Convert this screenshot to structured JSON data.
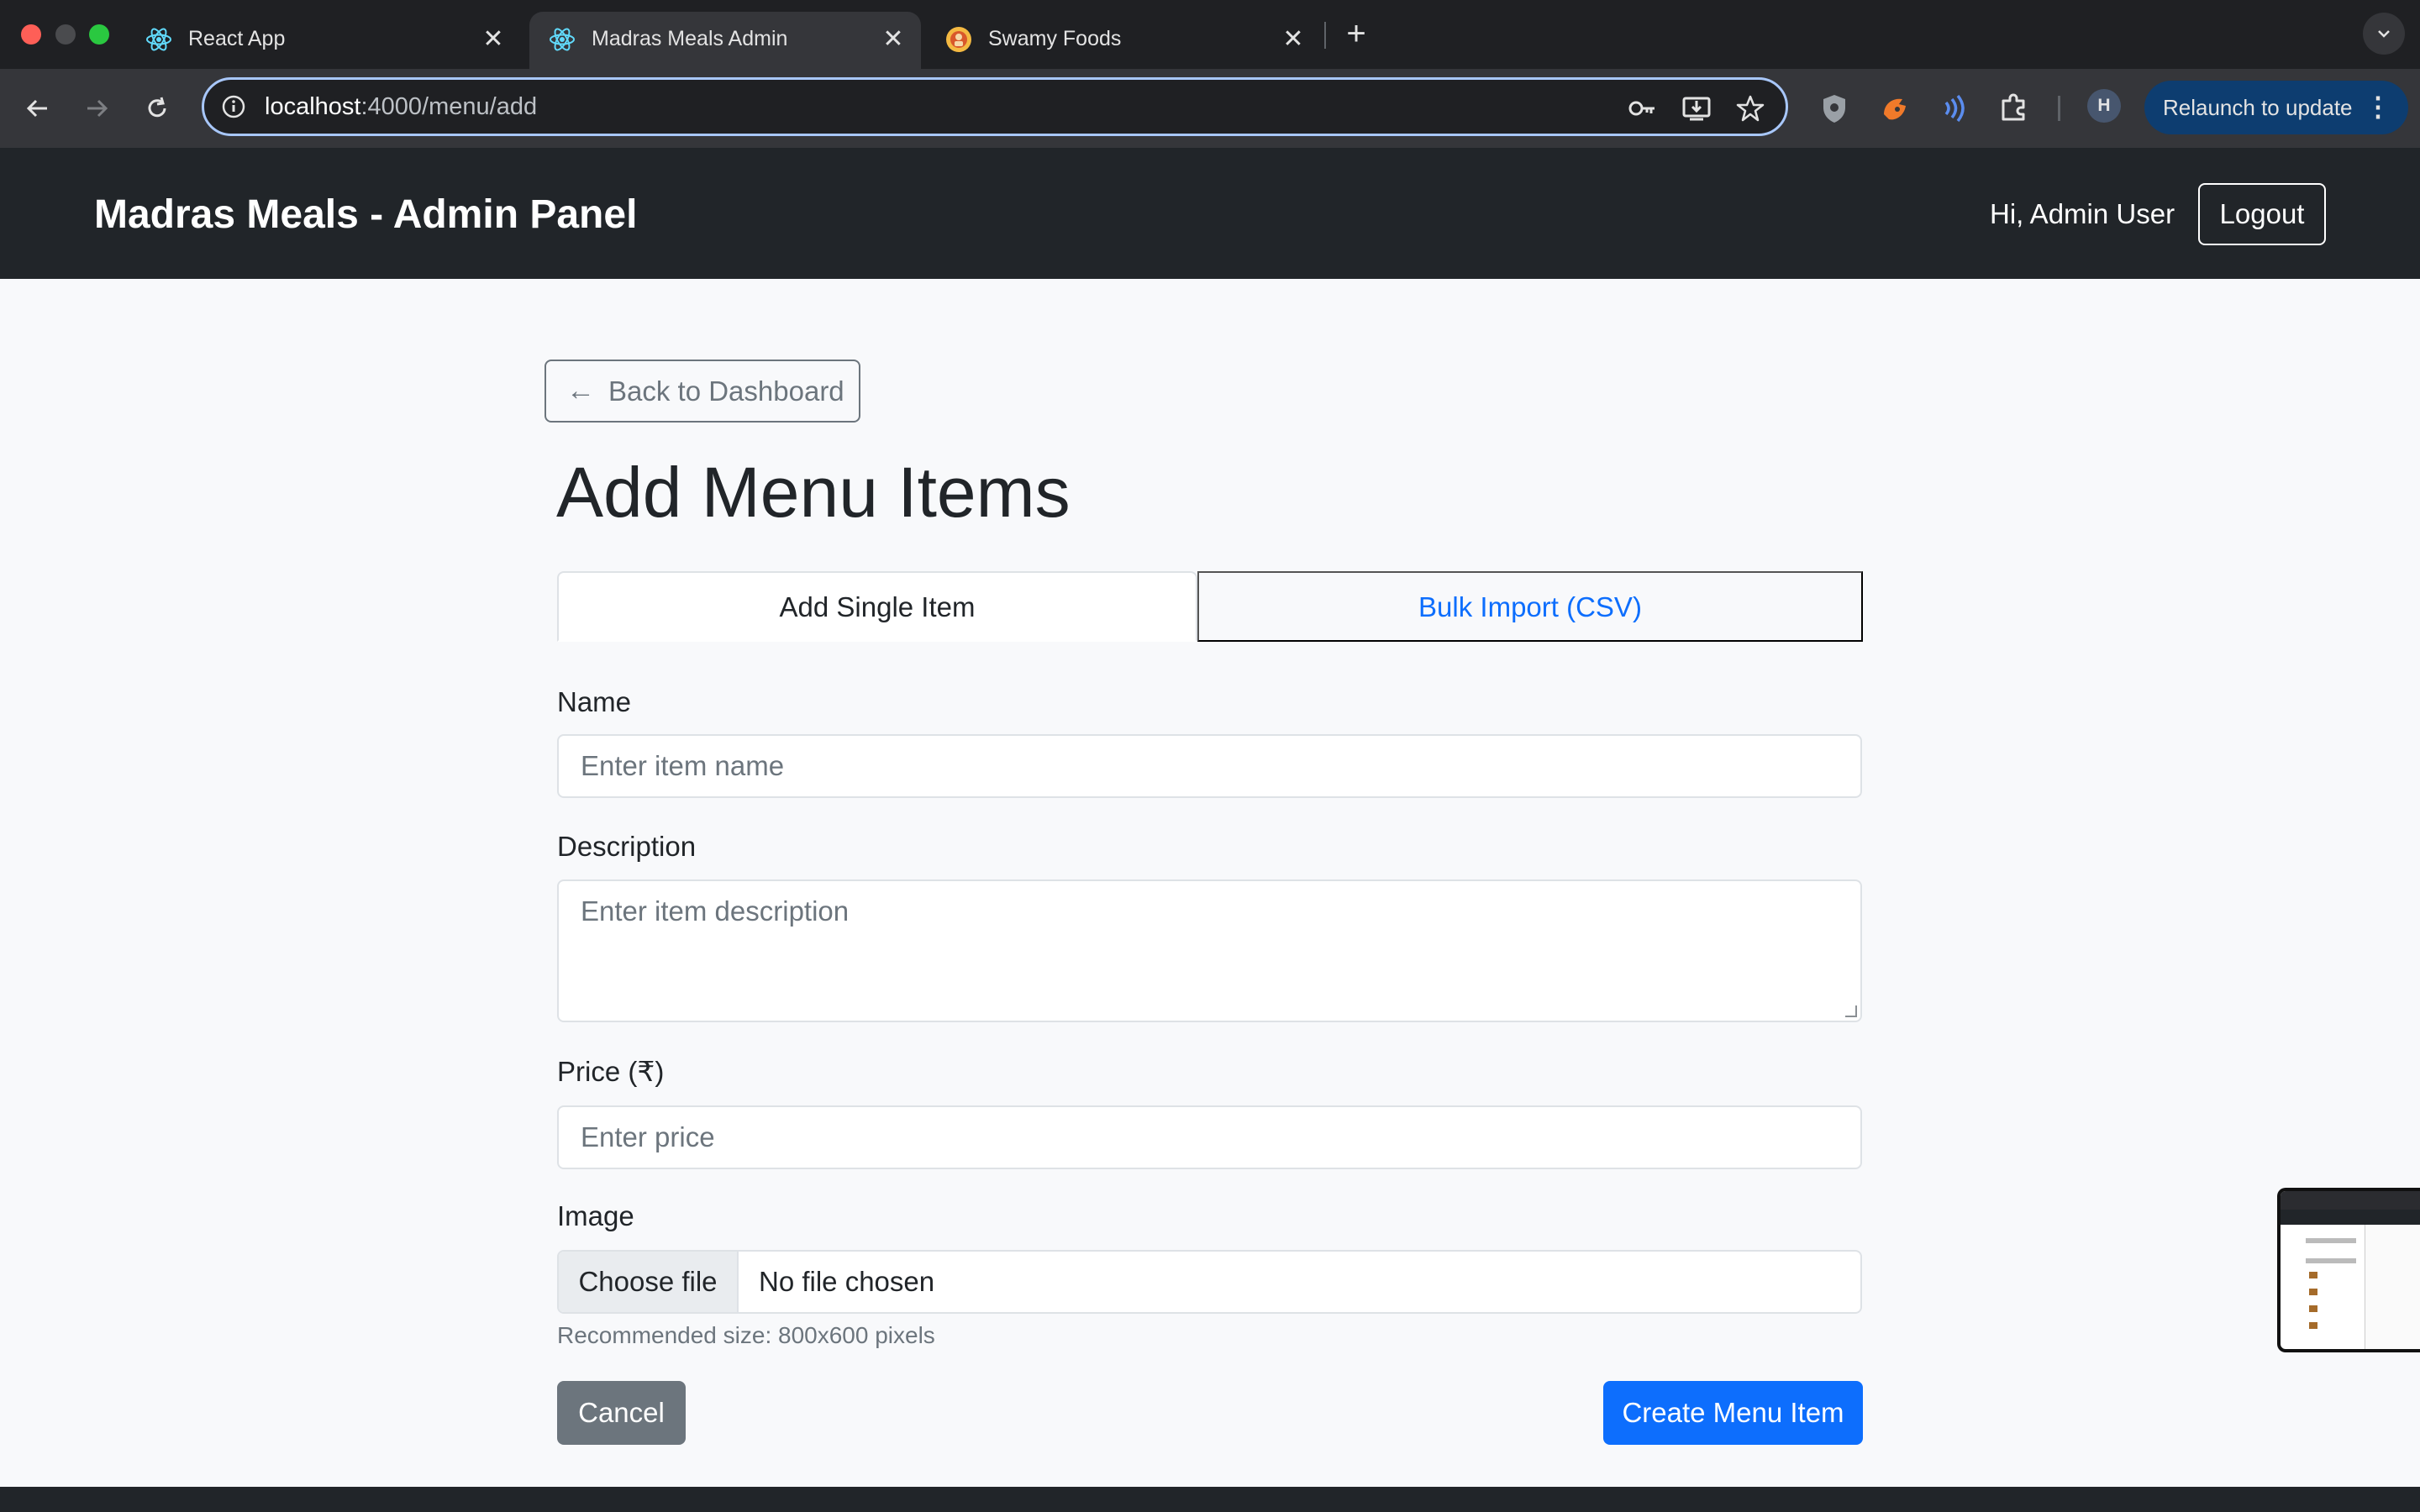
{
  "browser": {
    "tabs": [
      {
        "title": "React App",
        "icon": "react-icon",
        "active": false
      },
      {
        "title": "Madras Meals Admin",
        "icon": "react-icon",
        "active": true
      },
      {
        "title": "Swamy Foods",
        "icon": "food-logo-icon",
        "active": false
      }
    ],
    "close_glyph": "✕",
    "new_tab_glyph": "+",
    "url_host": "localhost",
    "url_rest": ":4000/menu/add",
    "relaunch_label": "Relaunch to update",
    "profile_initial": "H",
    "colors": {
      "tabbar": "#1f2023",
      "toolbar": "#35363a",
      "omnibox_border": "#a8c7fa",
      "relaunch_bg": "#0d3d70"
    }
  },
  "navbar": {
    "brand": "Madras Meals - Admin Panel",
    "greeting": "Hi, Admin User",
    "logout_label": "Logout"
  },
  "page": {
    "back_label": "Back to Dashboard",
    "back_icon": "arrow-left-icon",
    "title": "Add Menu Items",
    "tabs": [
      {
        "label": "Add Single Item",
        "active": true
      },
      {
        "label": "Bulk Import (CSV)",
        "active": false
      }
    ],
    "form": {
      "name_label": "Name",
      "name_placeholder": "Enter item name",
      "description_label": "Description",
      "description_placeholder": "Enter item description",
      "price_label": "Price (₹)",
      "price_placeholder": "Enter price",
      "image_label": "Image",
      "file_button": "Choose file",
      "file_status": "No file chosen",
      "image_help": "Recommended size: 800x600 pixels",
      "cancel_label": "Cancel",
      "submit_label": "Create Menu Item"
    },
    "colors": {
      "primary": "#0d6efd",
      "secondary": "#6c757d",
      "navbar_bg": "#212529",
      "page_bg": "#f8f9fb"
    }
  }
}
